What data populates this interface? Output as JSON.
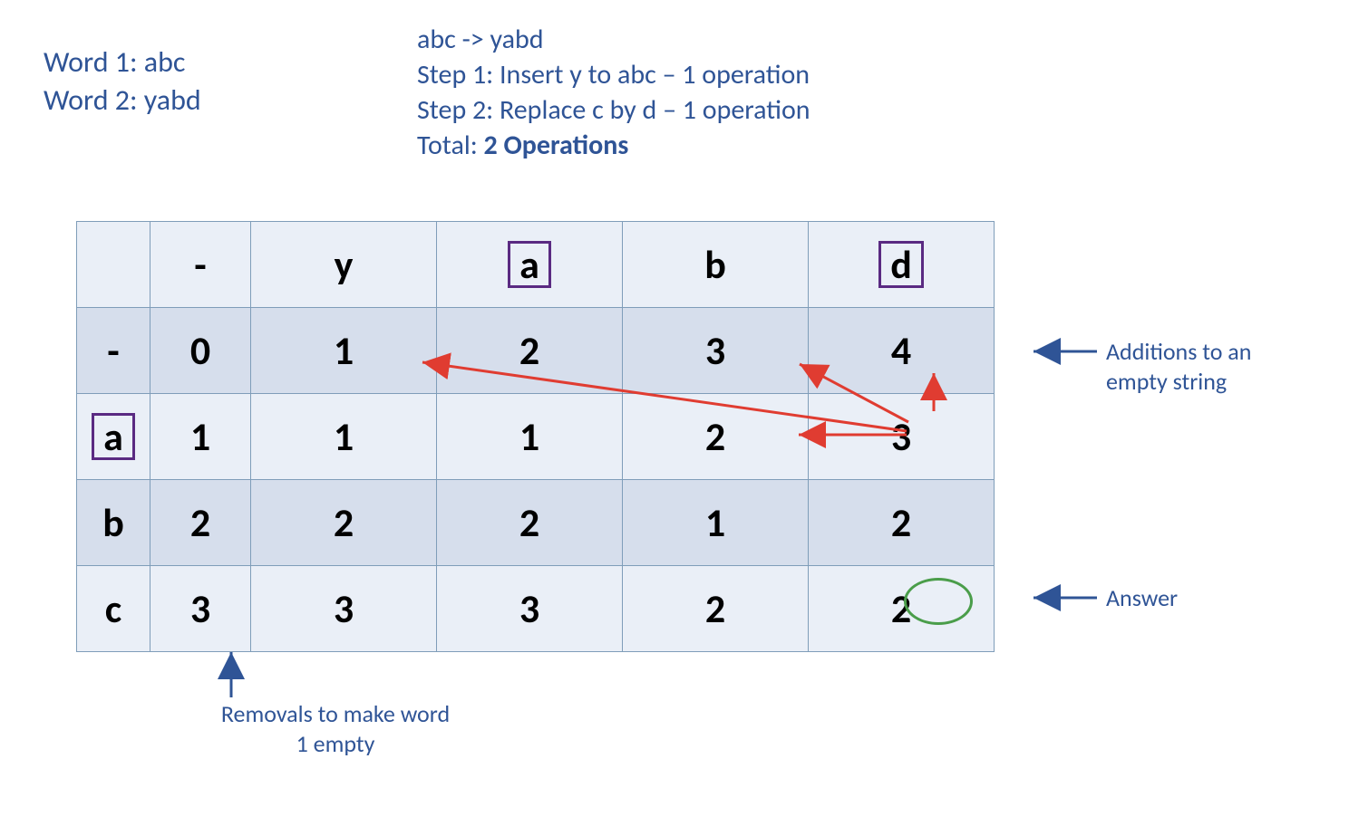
{
  "words": {
    "w1_label": "Word 1: abc",
    "w2_label": "Word 2: yabd"
  },
  "steps": {
    "transform": "abc ->  yabd",
    "s1": "Step 1: Insert y to abc – 1 operation",
    "s2": "Step 2: Replace c by d – 1 operation",
    "total_prefix": "Total: ",
    "total_bold": "2 Operations"
  },
  "table": {
    "col_headers": [
      "",
      "-",
      "y",
      "a",
      "b",
      "d"
    ],
    "row_headers": [
      "-",
      "a",
      "b",
      "c"
    ],
    "boxed_col_headers": [
      3,
      5
    ],
    "boxed_row_headers": [
      1
    ],
    "cells": [
      [
        0,
        1,
        2,
        3,
        4
      ],
      [
        1,
        1,
        1,
        2,
        3
      ],
      [
        2,
        2,
        2,
        1,
        2
      ],
      [
        3,
        3,
        3,
        2,
        2
      ]
    ],
    "answer_cell": {
      "row": 3,
      "col": 4
    }
  },
  "notes": {
    "additions": "Additions to an empty string",
    "answer": "Answer",
    "removals": "Removals to make word 1 empty"
  },
  "colors": {
    "blue": "#2f5496",
    "purple_box": "#5a2a82",
    "green": "#4a9d4a",
    "red_arrow": "#e03c31",
    "blue_arrow": "#2f5496"
  }
}
